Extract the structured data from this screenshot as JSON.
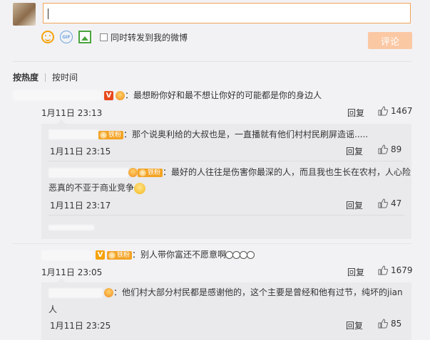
{
  "composer": {
    "forward_label": "同时转发到我的微博",
    "submit_label": "评论",
    "accent_color": "#f0a35a"
  },
  "sort": {
    "hot_label": "按热度",
    "time_label": "按时间"
  },
  "comments": [
    {
      "text": "：最想盼你好和最不想让你好的可能都是你的身边人",
      "time": "1月11日 23:13",
      "reply_label": "回复",
      "likes": "1467",
      "replies": [
        {
          "badge": "铁粉",
          "text": "：那个说奥利给的大叔也是，一直播就有他们村村民刷屏造谣.....",
          "time": "1月11日 23:15",
          "reply_label": "回复",
          "likes": "89"
        },
        {
          "badge": "铁粉",
          "text_line1": "：最好的人往往是伤害你最深的人，而且我也生长在农村，人心险",
          "text_line2": "恶真的不亚于商业竞争",
          "time": "1月11日 23:17",
          "reply_label": "回复",
          "likes": "47"
        }
      ]
    },
    {
      "badge": "铁粉",
      "text": "：别人带你富还不愿意啊",
      "time": "1月11日 23:05",
      "reply_label": "回复",
      "likes": "1679",
      "replies": [
        {
          "text_line1": "：他们村大部分村民都是感谢他的，这个主要是曾经和他有过节，纯坏的jian",
          "text_line2": "人",
          "time": "1月11日 23:25",
          "reply_label": "回复",
          "likes": "85"
        }
      ]
    }
  ]
}
